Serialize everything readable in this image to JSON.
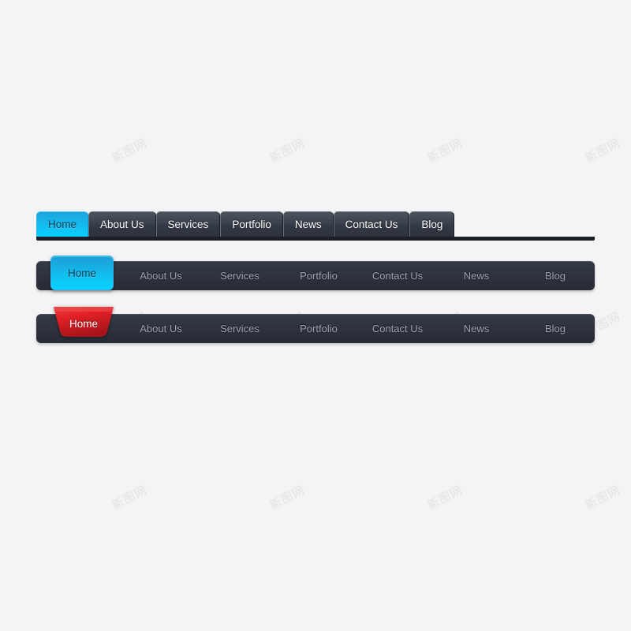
{
  "background": {
    "color": "#f4f4f4",
    "watermark_text": "新图网"
  },
  "navbars": [
    {
      "id": "tabs",
      "style_name": "separated-tabs",
      "active_color": "#10c4f4",
      "bar_color": "#343a46",
      "items": [
        {
          "label": "Home",
          "active": true
        },
        {
          "label": "About Us",
          "active": false
        },
        {
          "label": "Services",
          "active": false
        },
        {
          "label": "Portfolio",
          "active": false
        },
        {
          "label": "News",
          "active": false
        },
        {
          "label": "Contact Us",
          "active": false
        },
        {
          "label": "Blog",
          "active": false
        }
      ]
    },
    {
      "id": "raised",
      "style_name": "raised-button-bar",
      "active_color": "#10c3f3",
      "bar_color": "#2d323d",
      "active_label": "Home",
      "items": [
        {
          "label": "About Us",
          "active": false
        },
        {
          "label": "Services",
          "active": false
        },
        {
          "label": "Portfolio",
          "active": false
        },
        {
          "label": "Contact Us",
          "active": false
        },
        {
          "label": "News",
          "active": false
        },
        {
          "label": "Blog",
          "active": false
        }
      ]
    },
    {
      "id": "ribbon",
      "style_name": "ribbon-tab-bar",
      "active_color": "#d81f26",
      "bar_color": "#2d323d",
      "active_label": "Home",
      "items": [
        {
          "label": "About Us",
          "active": false
        },
        {
          "label": "Services",
          "active": false
        },
        {
          "label": "Portfolio",
          "active": false
        },
        {
          "label": "Contact Us",
          "active": false
        },
        {
          "label": "News",
          "active": false
        },
        {
          "label": "Blog",
          "active": false
        }
      ]
    }
  ]
}
